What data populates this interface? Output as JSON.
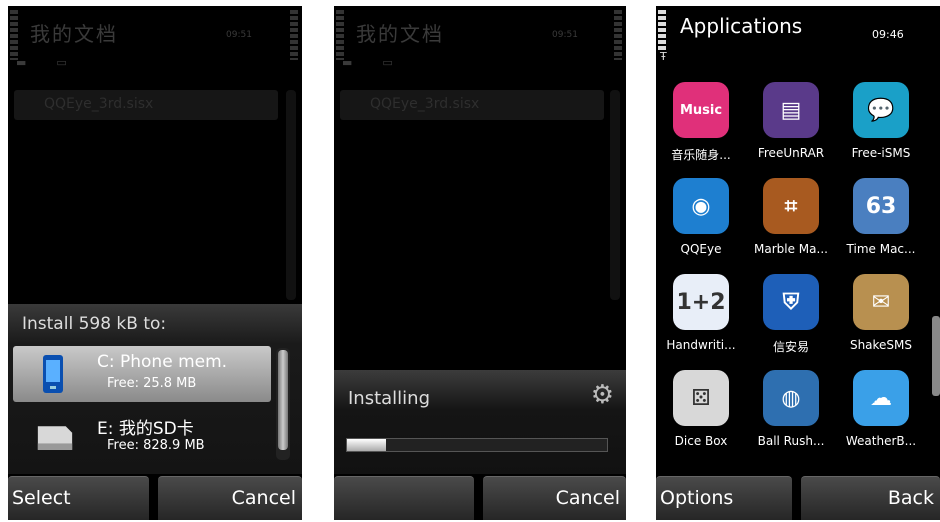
{
  "screen1": {
    "bg_title": "我的文档",
    "bg_time": "09:51",
    "bg_file": "QQEye_3rd.sisx",
    "dialog_title": "Install 598 kB to:",
    "options": [
      {
        "name": "C: Phone mem.",
        "free": "Free: 25.8 MB",
        "icon": "phone-icon"
      },
      {
        "name": "E: 我的SD卡",
        "free": "Free: 828.9 MB",
        "icon": "memory-card-icon"
      }
    ],
    "softkeys": {
      "left": "Select",
      "right": "Cancel"
    }
  },
  "screen2": {
    "bg_title": "我的文档",
    "bg_time": "09:51",
    "bg_file": "QQEye_3rd.sisx",
    "status": "Installing",
    "progress": 0.15,
    "softkeys": {
      "left": "",
      "right": "Cancel"
    }
  },
  "screen3": {
    "title": "Applications",
    "time": "09:46",
    "apps": [
      {
        "label": "音乐随身...",
        "icon": "music-icon",
        "color": "#e0307a",
        "glyph": "Music"
      },
      {
        "label": "FreeUnRAR",
        "icon": "archive-icon",
        "color": "#5a3a8a",
        "glyph": "▤"
      },
      {
        "label": "Free-iSMS",
        "icon": "chat-bubble-icon",
        "color": "#1aa0c8",
        "glyph": "💬"
      },
      {
        "label": "QQEye",
        "icon": "eye-icon",
        "color": "#1e7fd0",
        "glyph": "◉"
      },
      {
        "label": "Marble Ma...",
        "icon": "maze-icon",
        "color": "#a85a20",
        "glyph": "⌗"
      },
      {
        "label": "Time Mac...",
        "icon": "time-machine-icon",
        "color": "#4a7fc0",
        "glyph": "63"
      },
      {
        "label": "Handwriti...",
        "icon": "handwriting-icon",
        "color": "#e8eef8",
        "glyph": "1+2"
      },
      {
        "label": "信安易",
        "icon": "shield-icon",
        "color": "#1e5fb8",
        "glyph": "⛨"
      },
      {
        "label": "ShakeSMS",
        "icon": "envelope-icon",
        "color": "#b89050",
        "glyph": "✉"
      },
      {
        "label": "Dice Box",
        "icon": "dice-icon",
        "color": "#d8d8d8",
        "glyph": "⚄"
      },
      {
        "label": "Ball Rush...",
        "icon": "ball-rush-icon",
        "color": "#2e6fb0",
        "glyph": "◍"
      },
      {
        "label": "WeatherB...",
        "icon": "weather-icon",
        "color": "#3aa0e8",
        "glyph": "☁"
      }
    ],
    "softkeys": {
      "left": "Options",
      "right": "Back"
    }
  }
}
